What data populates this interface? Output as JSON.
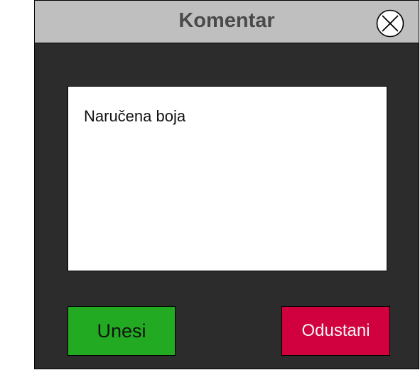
{
  "dialog": {
    "title": "Komentar",
    "close_icon": "close-circle-x-icon"
  },
  "comment": {
    "value": "Naručena boja"
  },
  "buttons": {
    "submit_label": "Unesi",
    "submit_color": "#22aa22",
    "cancel_label": "Odustani",
    "cancel_color": "#d1003f"
  }
}
